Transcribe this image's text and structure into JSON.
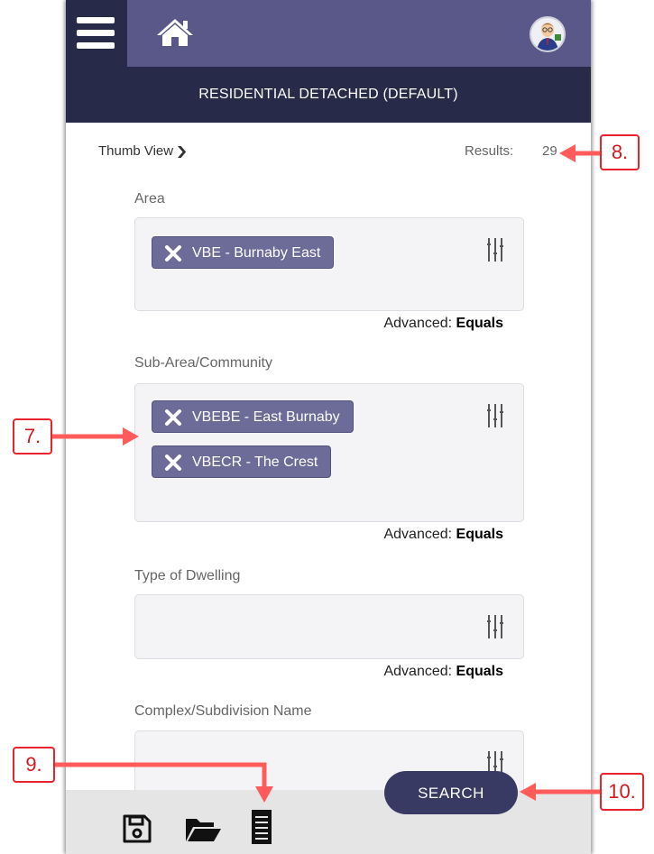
{
  "header": {
    "menu_icon": "hamburger-menu-icon",
    "home_icon": "home-icon",
    "avatar_icon": "user-avatar",
    "title": "RESIDENTIAL DETACHED (DEFAULT)"
  },
  "toolbar": {
    "view_label": "Thumb View",
    "results_label": "Results:",
    "results_count": "29"
  },
  "fields": [
    {
      "label": "Area",
      "chips": [
        "VBE - Burnaby East"
      ],
      "advanced_label": "Advanced:",
      "advanced_value": "Equals"
    },
    {
      "label": "Sub-Area/Community",
      "chips": [
        "VBEBE - East Burnaby",
        "VBECR - The Crest"
      ],
      "advanced_label": "Advanced:",
      "advanced_value": "Equals"
    },
    {
      "label": "Type of Dwelling",
      "chips": [],
      "advanced_label": "Advanced:",
      "advanced_value": "Equals"
    },
    {
      "label": "Complex/Subdivision Name",
      "chips": []
    }
  ],
  "bottom_bar": {
    "icons": [
      "save-icon",
      "folder-open-icon",
      "list-icon"
    ],
    "search_label": "SEARCH"
  },
  "annotations": [
    "7.",
    "8.",
    "9.",
    "10."
  ],
  "colors": {
    "header_light": "#5a5888",
    "header_dark": "#272a48",
    "chip": "#6d6b98",
    "search_button": "#383a63",
    "annotation": "#e8232b"
  }
}
